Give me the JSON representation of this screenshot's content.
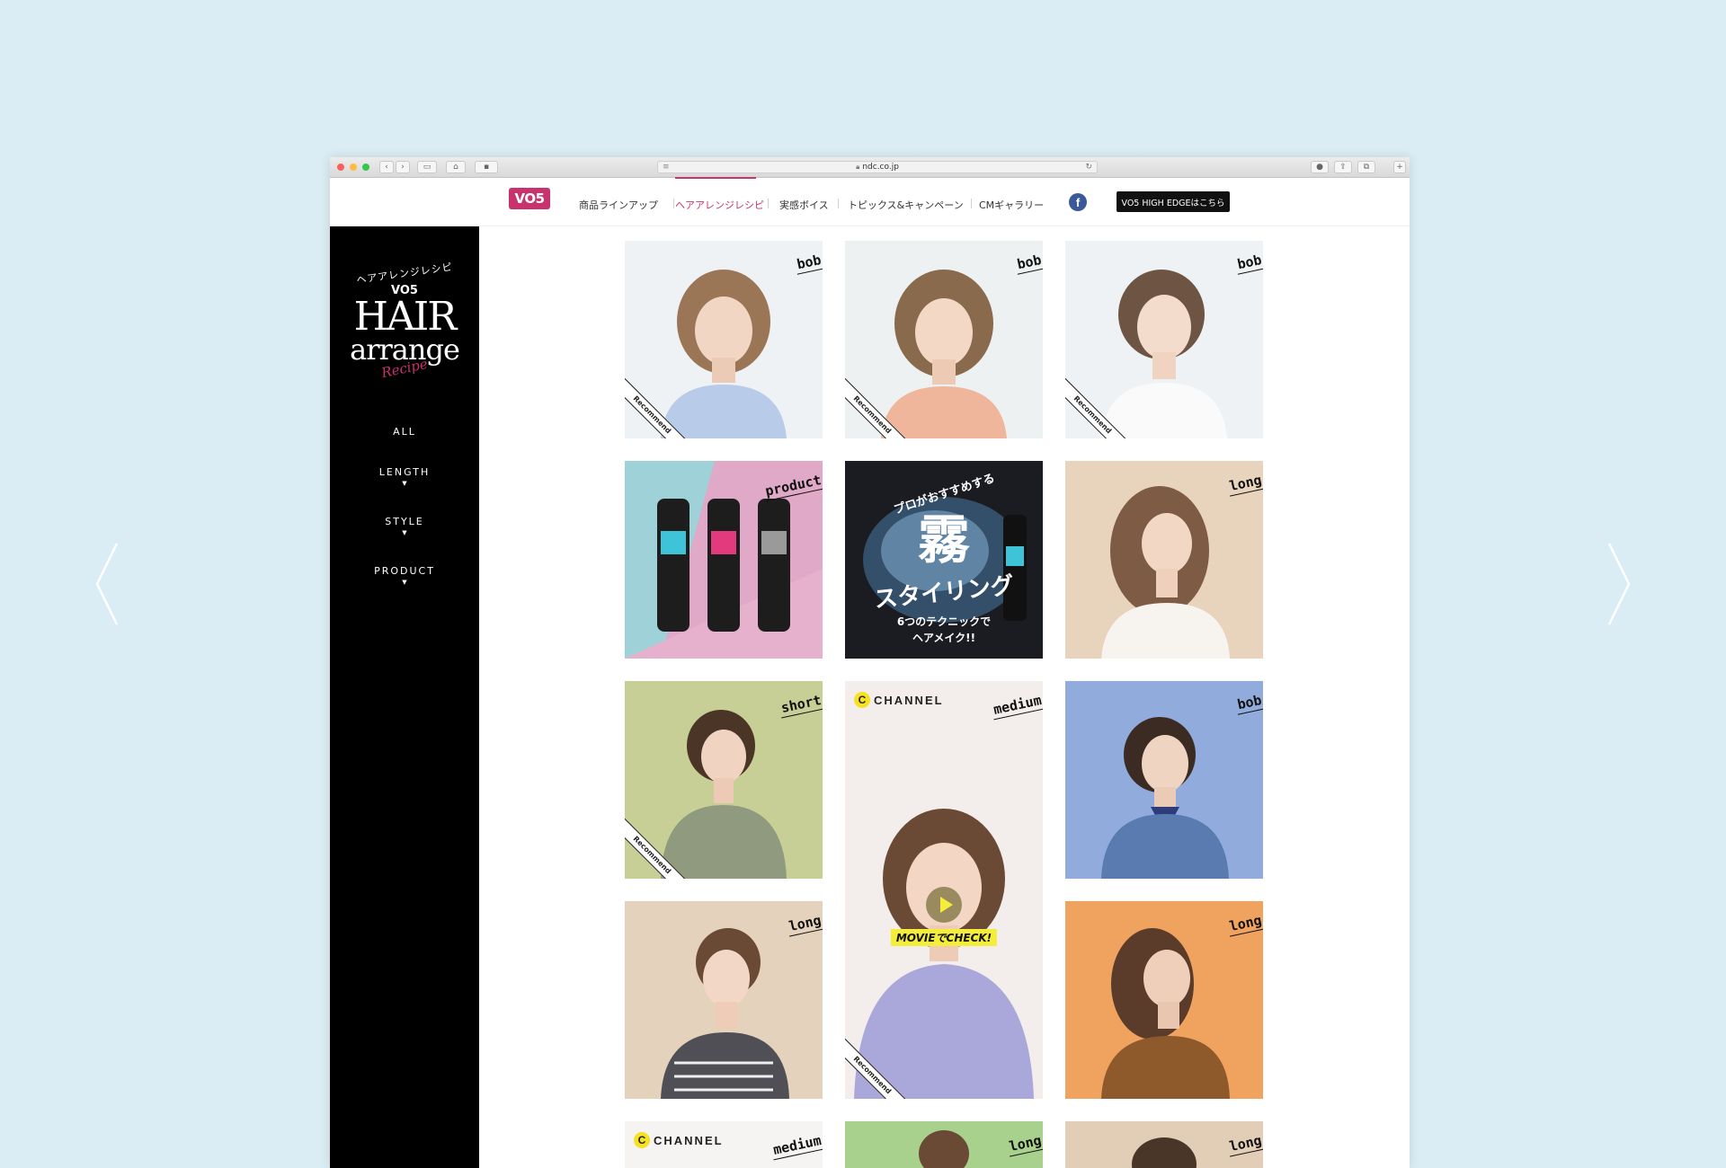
{
  "browser": {
    "url": "ndc.co.jp"
  },
  "nav": {
    "logo": "VO5",
    "items": [
      {
        "label": "商品ラインアップ"
      },
      {
        "label": "ヘアアレンジレシピ"
      },
      {
        "label": "実感ボイス"
      },
      {
        "label": "トピックス&キャンペーン"
      },
      {
        "label": "CMギャラリー"
      }
    ],
    "facebook": "f",
    "cta": "VO5 HIGH EDGEはこちら"
  },
  "sidebar": {
    "brand": {
      "top": "ヘアアレンジレシピ",
      "vo5": "VO5",
      "hair": "HAIR",
      "arrange": "arrange",
      "recipe": "Recipe"
    },
    "menu": [
      {
        "label": "ALL"
      },
      {
        "label": "LENGTH"
      },
      {
        "label": "STYLE"
      },
      {
        "label": "PRODUCT"
      }
    ]
  },
  "tiles": {
    "t1": {
      "tag": "bob",
      "ribbon": "Recommend"
    },
    "t2": {
      "tag": "bob",
      "ribbon": "Recommend"
    },
    "t3": {
      "tag": "bob",
      "ribbon": "Recommend"
    },
    "t4": {
      "tag": "product"
    },
    "t5": {
      "line1": "プロがおすすめする",
      "big": "霧",
      "line2": "スタイリング",
      "line3": "6つのテクニックで",
      "line4": "ヘアメイク!!"
    },
    "t6": {
      "tag": "long"
    },
    "t7": {
      "tag": "short",
      "ribbon": "Recommend"
    },
    "t8": {
      "channel": "CHANNEL",
      "channel_c": "C",
      "tag": "medium",
      "movie": "MOVIEでCHECK!",
      "ribbon": "Recommend"
    },
    "t9": {
      "tag": "bob"
    },
    "t10": {
      "tag": "long"
    },
    "t11": {
      "tag": "long"
    },
    "t12": {
      "channel": "CHANNEL",
      "channel_c": "C",
      "tag": "medium"
    },
    "t13": {
      "tag": "long"
    },
    "t14": {
      "tag": "long"
    }
  },
  "colors": {
    "brand": "#c8336e",
    "background": "#dbedf4"
  }
}
